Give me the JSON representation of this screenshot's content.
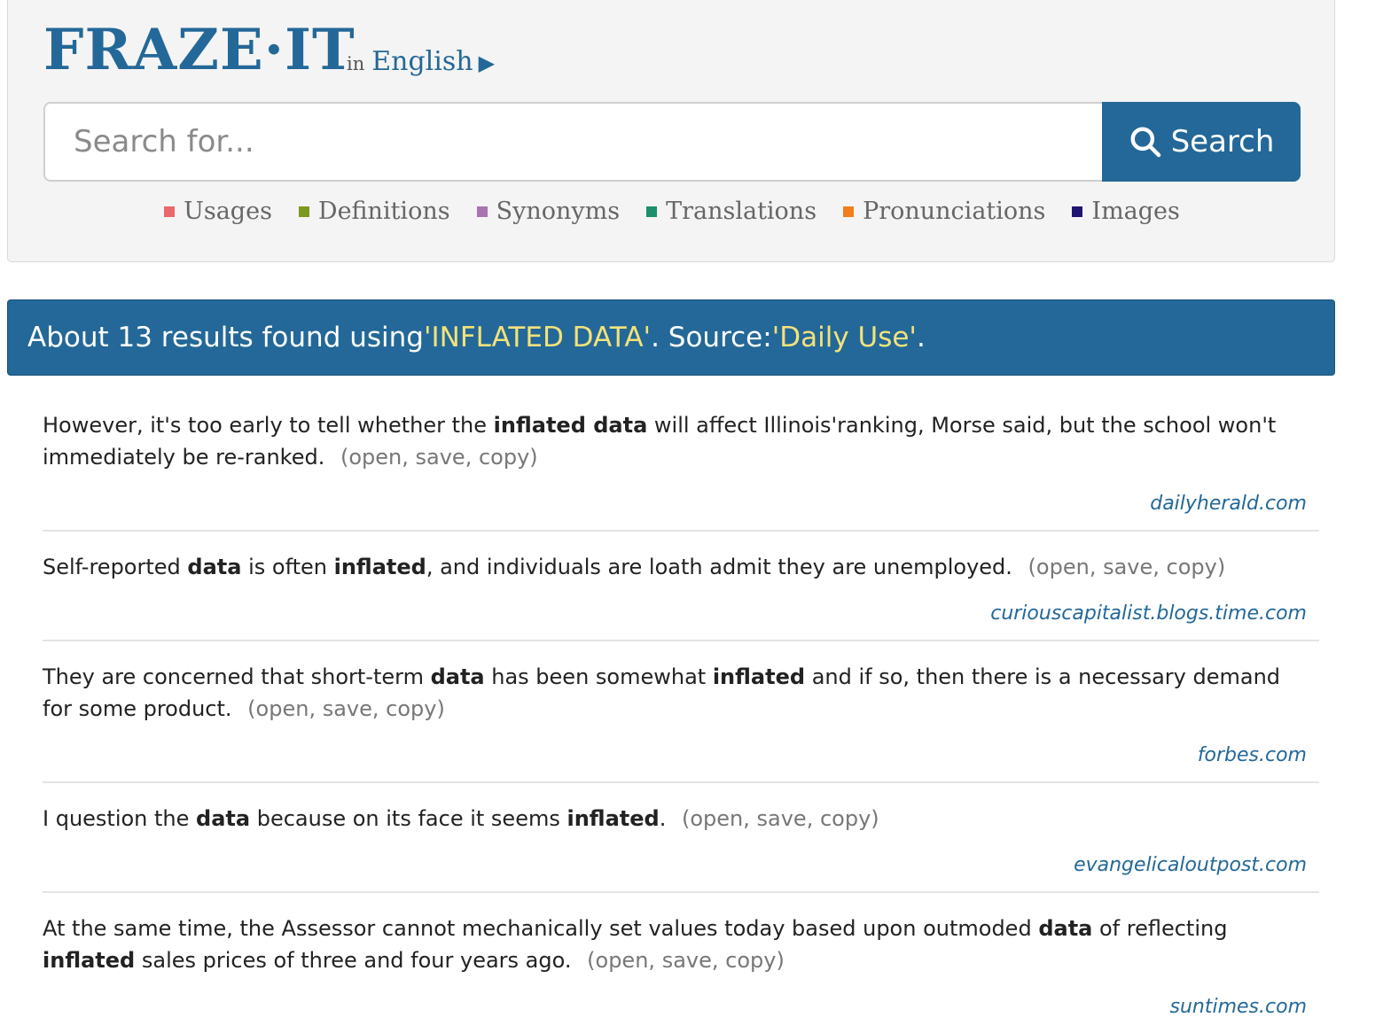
{
  "header": {
    "logo": "FRAZE·IT",
    "lang_prefix": "in",
    "lang": "English",
    "arrow": "▶"
  },
  "search": {
    "placeholder": "Search for...",
    "value": "",
    "button_label": "Search"
  },
  "categories": [
    {
      "label": "Usages",
      "color": "#e8686b"
    },
    {
      "label": "Definitions",
      "color": "#7a9a1f"
    },
    {
      "label": "Synonyms",
      "color": "#a875b0"
    },
    {
      "label": "Translations",
      "color": "#1c8f6c"
    },
    {
      "label": "Pronunciations",
      "color": "#f07f1c"
    },
    {
      "label": "Images",
      "color": "#1e1572"
    }
  ],
  "results_banner": {
    "prefix": "About 13 results found using ",
    "query": "'INFLATED DATA'",
    "middle": ". Source: ",
    "source": "'Daily Use'",
    "suffix": "."
  },
  "actions": {
    "open": "open",
    "save": "save",
    "copy": "copy"
  },
  "results": [
    {
      "parts": [
        {
          "t": "However, it's too early to tell whether the ",
          "b": false
        },
        {
          "t": "inflated data",
          "b": true
        },
        {
          "t": " will affect Illinois'ranking, Morse said, but the school won't immediately be re-ranked.",
          "b": false
        }
      ],
      "source": "dailyherald.com"
    },
    {
      "parts": [
        {
          "t": "Self-reported ",
          "b": false
        },
        {
          "t": "data",
          "b": true
        },
        {
          "t": " is often ",
          "b": false
        },
        {
          "t": "inflated",
          "b": true
        },
        {
          "t": ", and individuals are loath admit they are unemployed.",
          "b": false
        }
      ],
      "source": "curiouscapitalist.blogs.time.com"
    },
    {
      "parts": [
        {
          "t": "They are concerned that short-term ",
          "b": false
        },
        {
          "t": "data",
          "b": true
        },
        {
          "t": " has been somewhat ",
          "b": false
        },
        {
          "t": "inflated",
          "b": true
        },
        {
          "t": " and if so, then there is a necessary demand for some product.",
          "b": false
        }
      ],
      "source": "forbes.com"
    },
    {
      "parts": [
        {
          "t": "I question the ",
          "b": false
        },
        {
          "t": "data",
          "b": true
        },
        {
          "t": " because on its face it seems ",
          "b": false
        },
        {
          "t": "inflated",
          "b": true
        },
        {
          "t": ".",
          "b": false
        }
      ],
      "source": "evangelicaloutpost.com"
    },
    {
      "parts": [
        {
          "t": "At the same time, the Assessor cannot mechanically set values today based upon outmoded ",
          "b": false
        },
        {
          "t": "data",
          "b": true
        },
        {
          "t": " of reflecting ",
          "b": false
        },
        {
          "t": "inflated",
          "b": true
        },
        {
          "t": " sales prices of three and four years ago.",
          "b": false
        }
      ],
      "source": "suntimes.com"
    }
  ],
  "icons": {
    "search": "search-icon",
    "language_arrow": "play-arrow-icon"
  },
  "colors": {
    "brand": "#236898",
    "highlight": "#f3e27a"
  }
}
